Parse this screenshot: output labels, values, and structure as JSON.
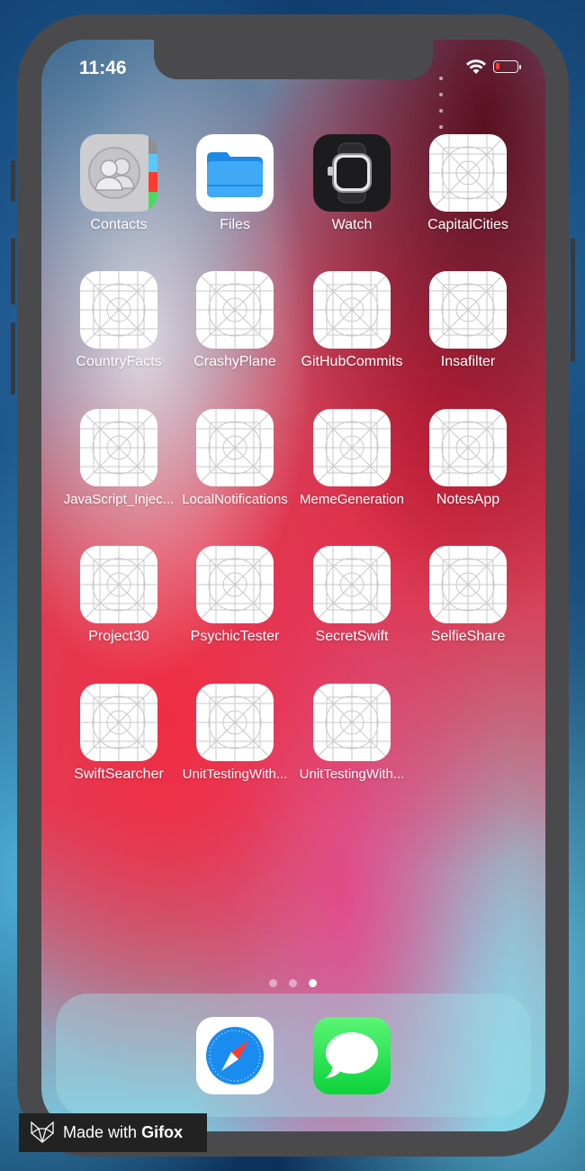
{
  "status_bar": {
    "time": "11:46"
  },
  "apps": [
    {
      "label": "Contacts",
      "icon": "contacts-icon"
    },
    {
      "label": "Files",
      "icon": "files-icon"
    },
    {
      "label": "Watch",
      "icon": "watch-icon"
    },
    {
      "label": "CapitalCities",
      "icon": "placeholder-app-icon"
    },
    {
      "label": "CountryFacts",
      "icon": "placeholder-app-icon"
    },
    {
      "label": "CrashyPlane",
      "icon": "placeholder-app-icon"
    },
    {
      "label": "GitHubCommits",
      "icon": "placeholder-app-icon"
    },
    {
      "label": "Insafilter",
      "icon": "placeholder-app-icon"
    },
    {
      "label": "JavaScript_Injec...",
      "icon": "placeholder-app-icon"
    },
    {
      "label": "LocalNotifications",
      "icon": "placeholder-app-icon"
    },
    {
      "label": "MemeGeneration",
      "icon": "placeholder-app-icon"
    },
    {
      "label": "NotesApp",
      "icon": "placeholder-app-icon"
    },
    {
      "label": "Project30",
      "icon": "placeholder-app-icon"
    },
    {
      "label": "PsychicTester",
      "icon": "placeholder-app-icon"
    },
    {
      "label": "SecretSwift",
      "icon": "placeholder-app-icon"
    },
    {
      "label": "SelfieShare",
      "icon": "placeholder-app-icon"
    },
    {
      "label": "SwiftSearcher",
      "icon": "placeholder-app-icon"
    },
    {
      "label": "UnitTestingWith...",
      "icon": "placeholder-app-icon"
    },
    {
      "label": "UnitTestingWith...",
      "icon": "placeholder-app-icon"
    }
  ],
  "page_indicator": {
    "pages": 3,
    "current": 3
  },
  "dock": [
    {
      "icon": "safari-icon"
    },
    {
      "icon": "messages-icon"
    }
  ],
  "watermark": {
    "text_prefix": "Made with",
    "brand": "Gifox"
  },
  "colors": {
    "messages_green": "#34c759",
    "safari_blue": "#1a8cf0",
    "files_blue": "#1e88e5",
    "battery_red": "#ff3b30"
  }
}
